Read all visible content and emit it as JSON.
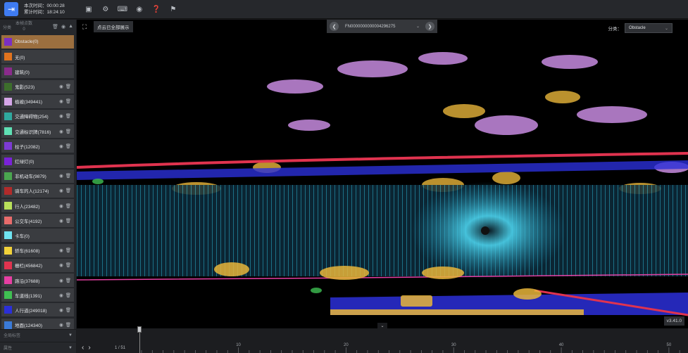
{
  "topbar": {
    "session_time": "本次时间：00:00:28",
    "total_time": "累计时间：18:24:10",
    "tools": [
      "save-icon",
      "settings-icon",
      "keyboard-icon",
      "rotate-icon",
      "help-icon",
      "flag-icon"
    ]
  },
  "sidebar": {
    "header_label": "分类",
    "count_label": "本帧点数",
    "count_value": "0",
    "classes": [
      {
        "label": "Obstacle(0)",
        "color": "#7b2fc4",
        "active": true,
        "actions": false
      },
      {
        "label": "无(0)",
        "color": "#e0731e",
        "active": false,
        "actions": false
      },
      {
        "label": "建筑(0)",
        "color": "#8a2b8c",
        "active": false,
        "actions": false
      },
      {
        "label": "鬼影(523)",
        "color": "#3d6e2c",
        "active": false,
        "actions": true
      },
      {
        "label": "植被(349441)",
        "color": "#d5a6e8",
        "active": false,
        "actions": true
      },
      {
        "label": "交通障碍物(254)",
        "color": "#2fa89e",
        "active": false,
        "actions": true
      },
      {
        "label": "交通标识牌(7816)",
        "color": "#5fe0b4",
        "active": false,
        "actions": true
      },
      {
        "label": "柱子(12082)",
        "color": "#7c3bd4",
        "active": false,
        "actions": true
      },
      {
        "label": "红绿灯(0)",
        "color": "#7a22d8",
        "active": false,
        "actions": false
      },
      {
        "label": "非机动车(9879)",
        "color": "#4aa64f",
        "active": false,
        "actions": true
      },
      {
        "label": "骑车的人(12174)",
        "color": "#b12b2b",
        "active": false,
        "actions": true
      },
      {
        "label": "行人(23482)",
        "color": "#b8e05a",
        "active": false,
        "actions": true
      },
      {
        "label": "公交车(4192)",
        "color": "#e86c6c",
        "active": false,
        "actions": true
      },
      {
        "label": "卡车(0)",
        "color": "#6fe3f0",
        "active": false,
        "actions": false
      },
      {
        "label": "轿车(61608)",
        "color": "#f2d23a",
        "active": false,
        "actions": true
      },
      {
        "label": "栅栏(456842)",
        "color": "#e0334f",
        "active": false,
        "actions": true
      },
      {
        "label": "路沿(37688)",
        "color": "#e63fa3",
        "active": false,
        "actions": true
      },
      {
        "label": "车道线(1391)",
        "color": "#3fbf52",
        "active": false,
        "actions": true
      },
      {
        "label": "人行道(249018)",
        "color": "#2b2fd8",
        "active": false,
        "actions": true
      },
      {
        "label": "地面(124340)",
        "color": "#3a7ad8",
        "active": false,
        "actions": true
      }
    ],
    "bottom_panels": [
      "全局标签",
      "属性"
    ]
  },
  "viewport": {
    "show_all_label": "点云已全部展示",
    "frame_id": "FN0000000000004296275",
    "category_label": "分类：",
    "category_value": "Obstacle",
    "version": "v3.41.0"
  },
  "timeline": {
    "page_label": "1 / 51",
    "tick_labels": [
      "10",
      "20",
      "30",
      "40",
      "50"
    ],
    "current_frame": 1,
    "total_frames": 51
  }
}
